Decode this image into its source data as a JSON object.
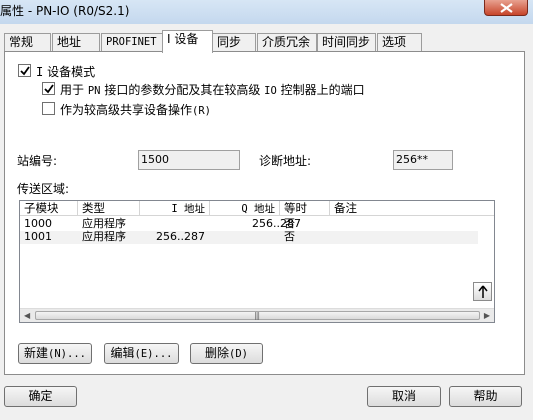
{
  "window": {
    "title": "属性 - PN-IO (R0/S2.1)"
  },
  "tabs": [
    {
      "label": "常规"
    },
    {
      "label": "地址"
    },
    {
      "label": "PROFINET"
    },
    {
      "label": "I 设备"
    },
    {
      "label": "同步"
    },
    {
      "label": "介质冗余"
    },
    {
      "label": "时间同步"
    },
    {
      "label": "选项"
    }
  ],
  "active_tab": "I 设备",
  "options": {
    "i_device_mode": {
      "prefix": "I",
      "label": "设备模式",
      "checked": true
    },
    "param_assign": {
      "pre": "用于",
      "pn": "PN",
      "mid": "接口的参数分配及其在较高级",
      "io": "IO",
      "post": "控制器上的端口",
      "checked": true
    },
    "shared_device": {
      "label": "作为较高级共享设备操作",
      "shortcut": "(R)",
      "checked": false
    }
  },
  "station": {
    "label": "站编号:",
    "value": "1500"
  },
  "diag_address": {
    "label": "诊断地址:",
    "value": "256**"
  },
  "transfer_area": {
    "label": "传送区域:",
    "columns": [
      "子模块",
      "类型",
      "I 地址",
      "Q 地址",
      "等时",
      "备注"
    ],
    "rows": [
      {
        "submodule": "1000",
        "type": "应用程序",
        "i_addr": "",
        "q_addr": "256..287",
        "isochronous": "否",
        "comment": ""
      },
      {
        "submodule": "1001",
        "type": "应用程序",
        "i_addr": "256..287",
        "q_addr": "",
        "isochronous": "否",
        "comment": ""
      }
    ]
  },
  "list_buttons": {
    "new": {
      "label": "新建",
      "shortcut": "(N)..."
    },
    "edit": {
      "label": "编辑",
      "shortcut": "(E)..."
    },
    "delete": {
      "label": "删除",
      "shortcut": "(D)"
    }
  },
  "footer": {
    "ok": "确定",
    "cancel": "取消",
    "help": "帮助"
  },
  "icons": {
    "move_up": "arrow-up-icon",
    "move_down": "arrow-down-icon",
    "close": "close-icon",
    "scroll_left": "triangle-left-icon",
    "scroll_right": "triangle-right-icon"
  }
}
